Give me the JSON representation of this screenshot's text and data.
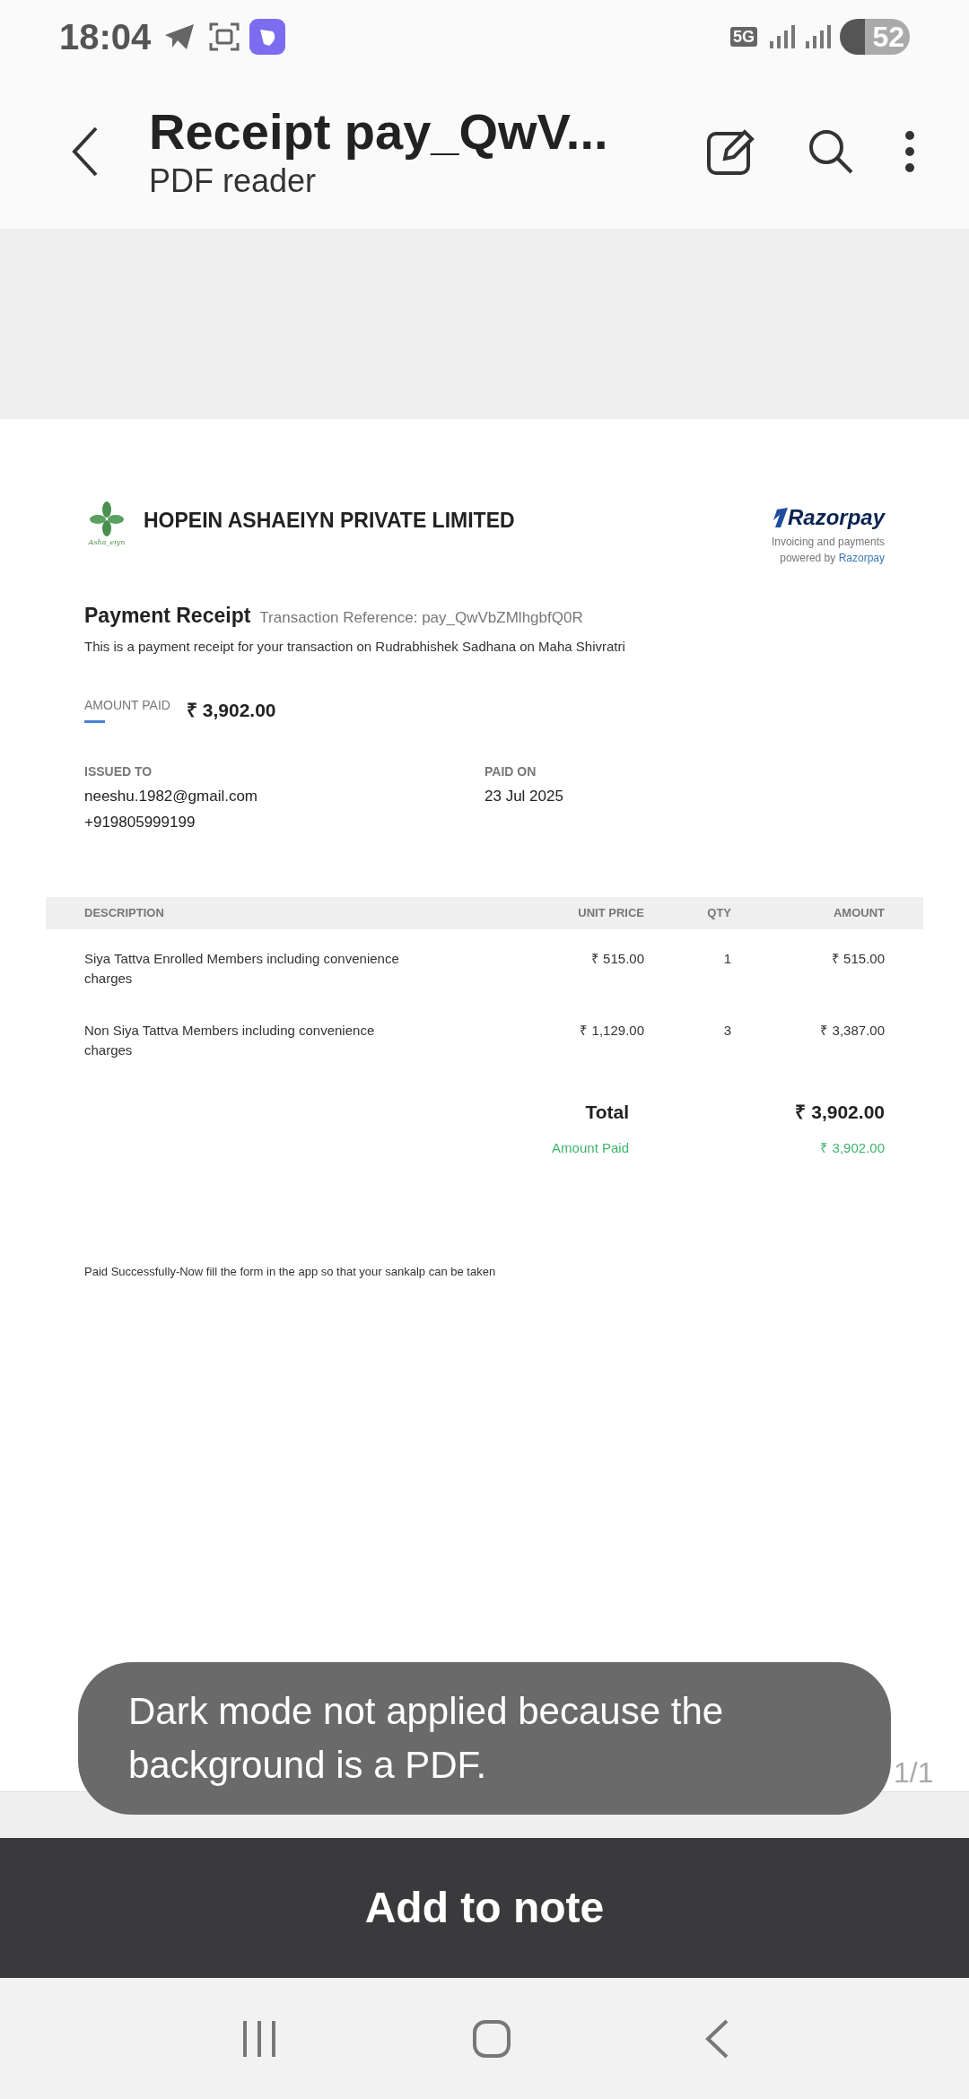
{
  "status_bar": {
    "time": "18:04",
    "network": "5G",
    "battery": "52"
  },
  "header": {
    "title": "Receipt pay_QwV...",
    "subtitle": "PDF reader"
  },
  "receipt": {
    "company": "HOPEIN ASHAEIYN PRIVATE LIMITED",
    "logo_caption": "Asha_eiyn",
    "brand": "Razorpay",
    "brand_tagline": "Invoicing and payments",
    "brand_powered": "powered by",
    "brand_link": "Razorpay",
    "title": "Payment Receipt",
    "reference": "Transaction Reference: pay_QwVbZMlhgbfQ0R",
    "intro": "This is a payment receipt for your transaction on Rudrabhishek Sadhana on Maha Shivratri",
    "amount_label": "AMOUNT PAID",
    "amount": "₹ 3,902.00",
    "issued_to_label": "ISSUED TO",
    "issued_to": [
      "neeshu.1982@gmail.com",
      "+919805999199"
    ],
    "paid_on_label": "PAID ON",
    "paid_on": "23 Jul 2025",
    "table": {
      "columns": [
        "DESCRIPTION",
        "UNIT PRICE",
        "QTY",
        "AMOUNT"
      ],
      "rows": [
        [
          "Siya Tattva Enrolled Members including convenience charges",
          "₹ 515.00",
          "1",
          "₹ 515.00"
        ],
        [
          "Non Siya Tattva Members including convenience charges",
          "₹ 1,129.00",
          "3",
          "₹ 3,387.00"
        ]
      ]
    },
    "total_label": "Total",
    "total": "₹ 3,902.00",
    "paid_label": "Amount Paid",
    "paid": "₹ 3,902.00",
    "note": "Paid Successfully-Now fill the form in the app so that your sankalp can be taken"
  },
  "page_indicator": "1/1",
  "toast": "Dark mode not applied because the background is a PDF.",
  "action_button": "Add to note"
}
